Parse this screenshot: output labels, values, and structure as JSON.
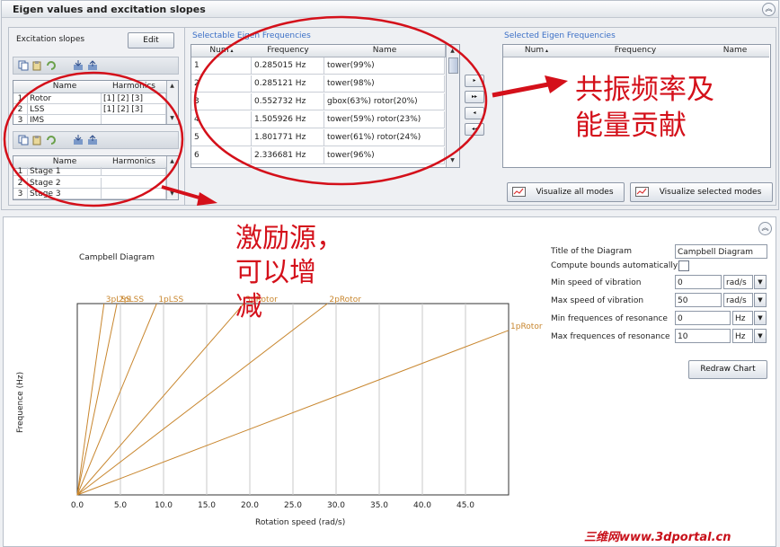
{
  "top": {
    "title": "Eigen values and excitation slopes",
    "excitation": {
      "label": "Excitation slopes",
      "edit_label": "Edit",
      "table1": {
        "headers": [
          "",
          "Name",
          "Harmonics"
        ],
        "rows": [
          {
            "num": "1",
            "name": "Rotor",
            "harm": "[1]  [2]  [3]"
          },
          {
            "num": "2",
            "name": "LSS",
            "harm": "[1]  [2]  [3]"
          },
          {
            "num": "3",
            "name": "IMS",
            "harm": ""
          }
        ]
      },
      "table2": {
        "headers": [
          "",
          "Name",
          "Harmonics"
        ],
        "rows": [
          {
            "num": "1",
            "name": "Stage 1",
            "harm": ""
          },
          {
            "num": "2",
            "name": "Stage 2",
            "harm": ""
          },
          {
            "num": "3",
            "name": "Stage 3",
            "harm": ""
          }
        ]
      }
    },
    "selectable": {
      "label": "Selectable Eigen Frequencies",
      "headers": [
        "Num",
        "Frequency",
        "Name"
      ],
      "rows": [
        {
          "num": "1",
          "freq": "0.285015 Hz",
          "name": "tower(99%)"
        },
        {
          "num": "2",
          "freq": "0.285121 Hz",
          "name": "tower(98%)"
        },
        {
          "num": "3",
          "freq": "0.552732 Hz",
          "name": "gbox(63%) rotor(20%)"
        },
        {
          "num": "4",
          "freq": "1.505926 Hz",
          "name": "tower(59%) rotor(23%)"
        },
        {
          "num": "5",
          "freq": "1.801771 Hz",
          "name": "tower(61%) rotor(24%)"
        },
        {
          "num": "6",
          "freq": "2.336681 Hz",
          "name": "tower(96%)"
        }
      ]
    },
    "selected": {
      "label": "Selected Eigen Frequencies",
      "headers": [
        "Num",
        "Frequency",
        "Name"
      ]
    },
    "visualize_all": "Visualize all modes",
    "visualize_selected": "Visualize selected modes"
  },
  "annotations": {
    "resonance": "共振频率及\n能量贡献",
    "excitation": "激励源，\n可以增\n减"
  },
  "chart_data": {
    "type": "line",
    "title": "Campbell Diagram",
    "xlabel": "Rotation speed (rad/s)",
    "ylabel": "Frequence (Hz)",
    "xlim": [
      0,
      50
    ],
    "ylim": [
      0,
      10
    ],
    "x_ticks": [
      "0.0",
      "5.0",
      "10.0",
      "15.0",
      "20.0",
      "25.0",
      "30.0",
      "35.0",
      "40.0",
      "45.0"
    ],
    "grid": true,
    "line_color": "#c8862e",
    "series": [
      {
        "name": "3pLSS",
        "x": [
          0,
          3.1
        ],
        "y": [
          0,
          10
        ]
      },
      {
        "name": "2pLSS",
        "x": [
          0,
          4.6
        ],
        "y": [
          0,
          10
        ]
      },
      {
        "name": "1pLSS",
        "x": [
          0,
          9.2
        ],
        "y": [
          0,
          10
        ]
      },
      {
        "name": "3pRotor",
        "x": [
          0,
          19.3
        ],
        "y": [
          0,
          10
        ]
      },
      {
        "name": "2pRotor",
        "x": [
          0,
          29.0
        ],
        "y": [
          0,
          10
        ]
      },
      {
        "name": "1pRotor",
        "x": [
          0,
          50
        ],
        "y": [
          0,
          8.6
        ]
      }
    ]
  },
  "settings": {
    "title_label": "Title of the Diagram",
    "title_value": "Campbell Diagram",
    "bounds_label": "Compute bounds automatically",
    "min_speed_label": "Min speed of vibration",
    "min_speed_value": "0",
    "min_speed_unit": "rad/s",
    "max_speed_label": "Max speed of vibration",
    "max_speed_value": "50",
    "max_speed_unit": "rad/s",
    "min_freq_label": "Min frequences of resonance",
    "min_freq_value": "0",
    "min_freq_unit": "Hz",
    "max_freq_label": "Max frequences of resonance",
    "max_freq_value": "10",
    "max_freq_unit": "Hz",
    "redraw_label": "Redraw Chart"
  },
  "watermark": "三维网www.3dportal.cn",
  "colors": {
    "red": "#d4101a",
    "orange": "#c8862e",
    "blue": "#3b6fc6"
  }
}
